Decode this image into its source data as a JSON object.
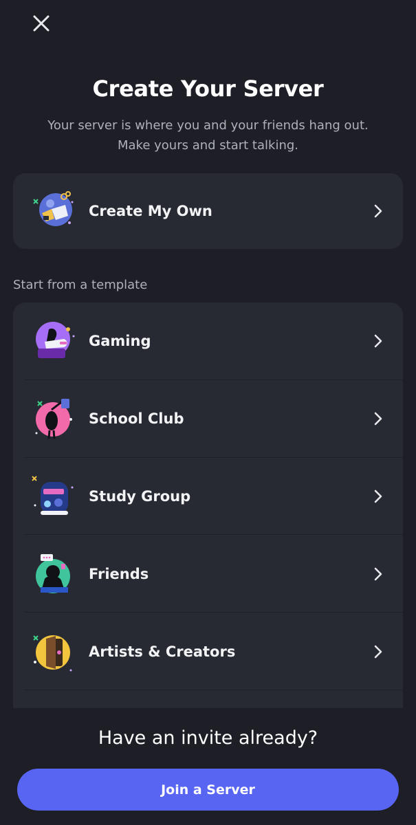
{
  "header": {
    "close_icon": "close-icon",
    "title": "Create Your Server",
    "subtitle_line1": "Your server is where you and your friends hang out.",
    "subtitle_line2": "Make yours and start talking."
  },
  "create_own": {
    "label": "Create My Own",
    "icon": "create-own-illustration-icon"
  },
  "templates": {
    "section_label": "Start from a template",
    "items": [
      {
        "label": "Gaming",
        "icon": "gaming-illustration-icon"
      },
      {
        "label": "School Club",
        "icon": "school-club-illustration-icon"
      },
      {
        "label": "Study Group",
        "icon": "study-group-illustration-icon"
      },
      {
        "label": "Friends",
        "icon": "friends-illustration-icon"
      },
      {
        "label": "Artists & Creators",
        "icon": "artists-creators-illustration-icon"
      }
    ]
  },
  "invite": {
    "title": "Have an invite already?",
    "join_label": "Join a Server"
  },
  "colors": {
    "background": "#1e1f26",
    "card": "#282a33",
    "accent": "#5865f2",
    "muted_text": "#aeb1b9"
  }
}
